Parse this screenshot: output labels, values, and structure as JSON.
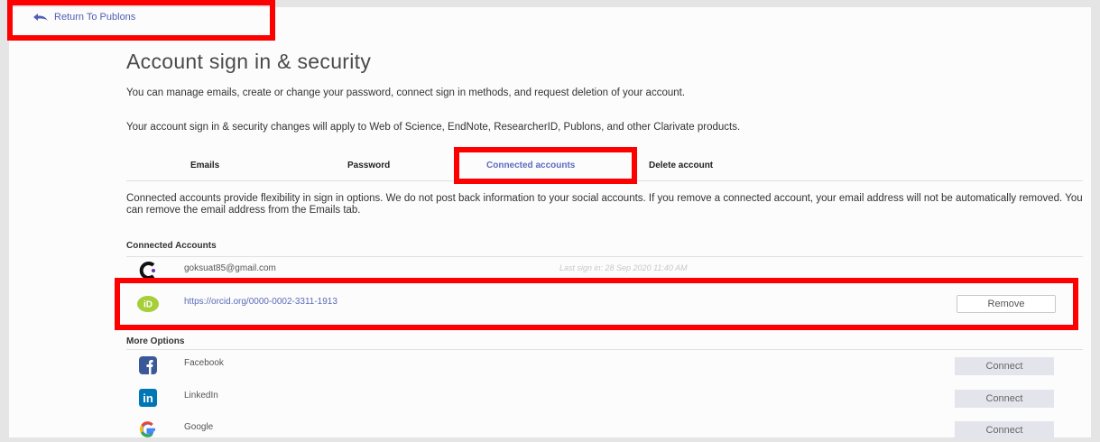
{
  "return_link": {
    "label": "Return To Publons"
  },
  "page": {
    "title": "Account sign in & security",
    "desc1": "You can manage emails, create or change your password, connect sign in methods, and request deletion of your account.",
    "desc2": "Your account sign in & security changes will apply to Web of Science, EndNote, ResearcherID, Publons, and other Clarivate products."
  },
  "tabs": [
    {
      "label": "Emails"
    },
    {
      "label": "Password"
    },
    {
      "label": "Connected accounts",
      "active": true
    },
    {
      "label": "Delete account"
    }
  ],
  "connected": {
    "info": "Connected accounts provide flexibility in sign in options. We do not post back information to your social accounts. If you remove a connected account, your email address will not be automatically removed. You can remove the email address from the Emails tab.",
    "heading": "Connected Accounts",
    "accounts": [
      {
        "icon": "clarivate-icon",
        "label": "goksuat85@gmail.com",
        "last_sign_in": "Last sign in: 28 Sep 2020 11:40 AM"
      },
      {
        "icon": "orcid-icon",
        "label": "https://orcid.org/0000-0002-3311-1913",
        "button": "Remove"
      }
    ]
  },
  "more_options": {
    "heading": "More Options",
    "items": [
      {
        "icon": "facebook-icon",
        "label": "Facebook",
        "button": "Connect"
      },
      {
        "icon": "linkedin-icon",
        "label": "LinkedIn",
        "button": "Connect"
      },
      {
        "icon": "google-icon",
        "label": "Google",
        "button": "Connect"
      }
    ]
  },
  "colors": {
    "highlight": "#ff0000",
    "accent": "#5c6bc0",
    "orcid": "#a6ce39",
    "facebook": "#3b5998",
    "linkedin": "#0077b5"
  }
}
